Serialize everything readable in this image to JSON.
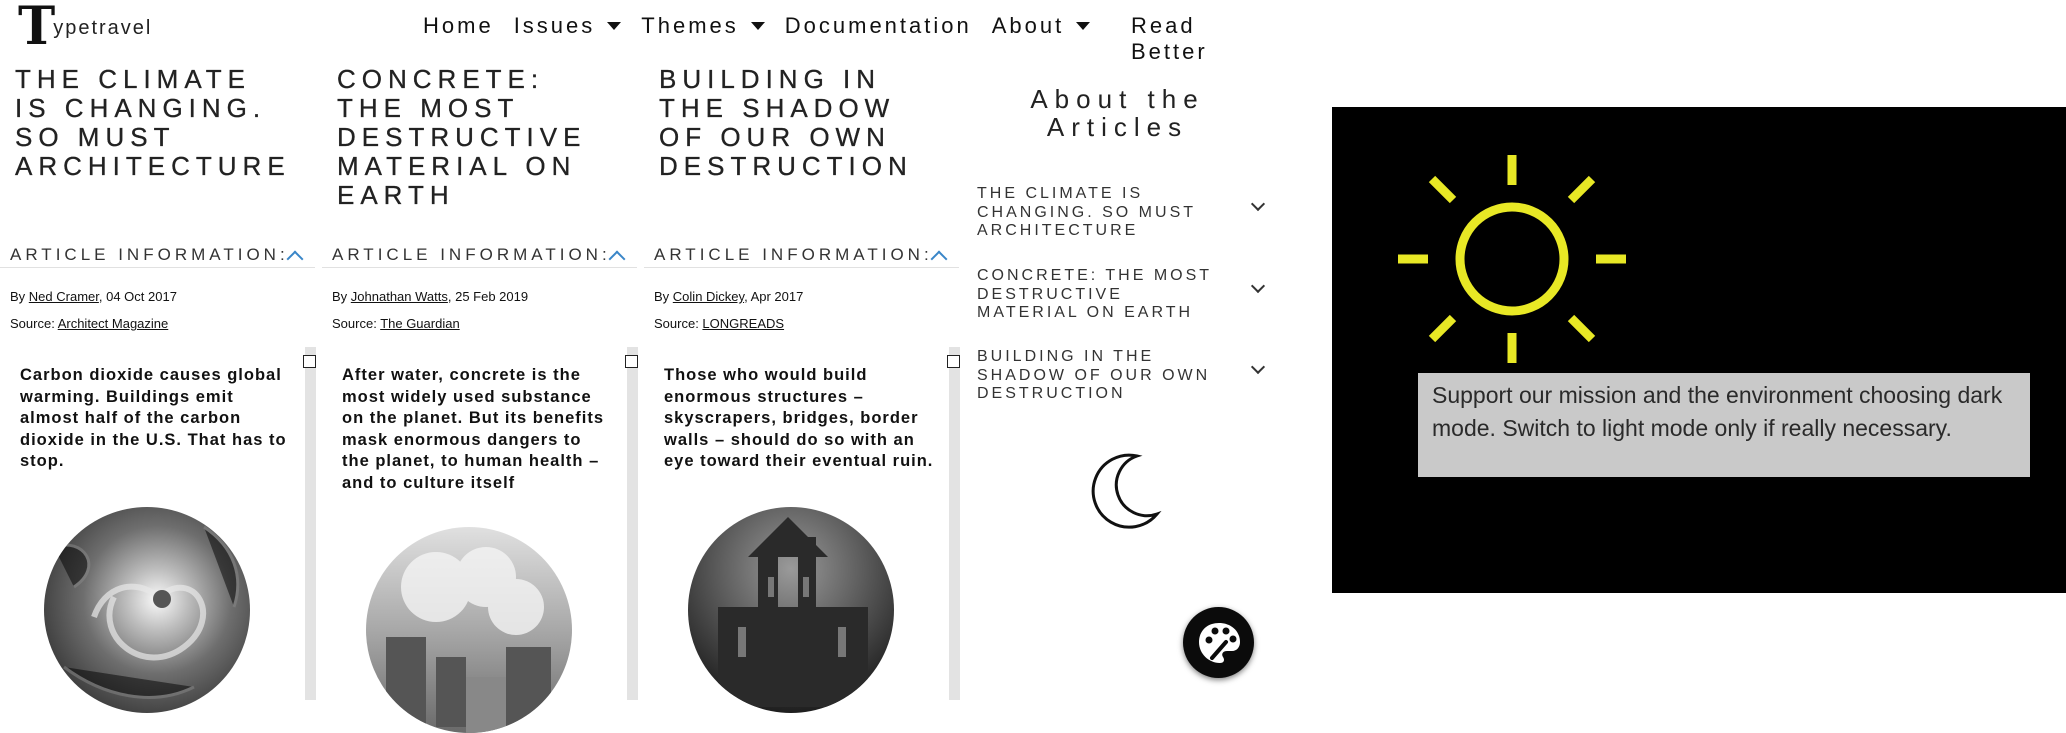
{
  "header": {
    "logo_mark": "T",
    "logo_text": "ypetravel",
    "nav": [
      {
        "label": "Home",
        "dropdown": false
      },
      {
        "label": "Issues",
        "dropdown": true
      },
      {
        "label": "Themes",
        "dropdown": true
      },
      {
        "label": "Documentation",
        "dropdown": false
      },
      {
        "label": "About",
        "dropdown": true
      }
    ],
    "read_better": "Read Better"
  },
  "articles": [
    {
      "title": "The Climate is Changing. So Must Architecture",
      "info_label": "Article Information:",
      "by_prefix": "By ",
      "author": "Ned Cramer",
      "date": ", 04 Oct 2017",
      "source_prefix": "Source: ",
      "source": "Architect Magazine",
      "excerpt": "Carbon dioxide causes global warming. Buildings emit almost half of the carbon dioxide in the U.S. That has to stop.",
      "image_icon": "hurricane-image"
    },
    {
      "title": "Concrete: the most destructive material on Earth",
      "info_label": "Article Information:",
      "by_prefix": "By ",
      "author": "Johnathan Watts",
      "date": ", 25 Feb 2019",
      "source_prefix": "Source: ",
      "source": "The Guardian",
      "excerpt": "After water, concrete is the most widely used substance on the planet. But its benefits mask enormous dangers to the planet, to human health – and to culture itself",
      "image_icon": "demolition-image"
    },
    {
      "title": "Building in the Shadow of Our Own Destruction",
      "info_label": "Article Information:",
      "by_prefix": "By ",
      "author": "Colin Dickey",
      "date": ", Apr 2017",
      "source_prefix": "Source: ",
      "source": "LONGREADS",
      "excerpt": "Those who would build enormous structures – skyscrapers, bridges, border walls – should do so with an eye toward their eventual ruin.",
      "image_icon": "ruin-image"
    }
  ],
  "about": {
    "title_line1": "About the",
    "title_line2": "Articles",
    "items": [
      "The Climate is Changing. So Must Architecture",
      "Concrete: the most destructive material on earth",
      "Building in the Shadow of Our Own Destruction"
    ]
  },
  "dark_mode": {
    "icon": "moon-icon",
    "tooltip": "Support our mission and the environment choosing dark mode. Switch to light mode only if really necessary."
  },
  "colors": {
    "accent": "#3a86c8",
    "sun": "#e8e825",
    "dark_bg": "#000000",
    "tooltip_bg": "#c9c9c9"
  }
}
